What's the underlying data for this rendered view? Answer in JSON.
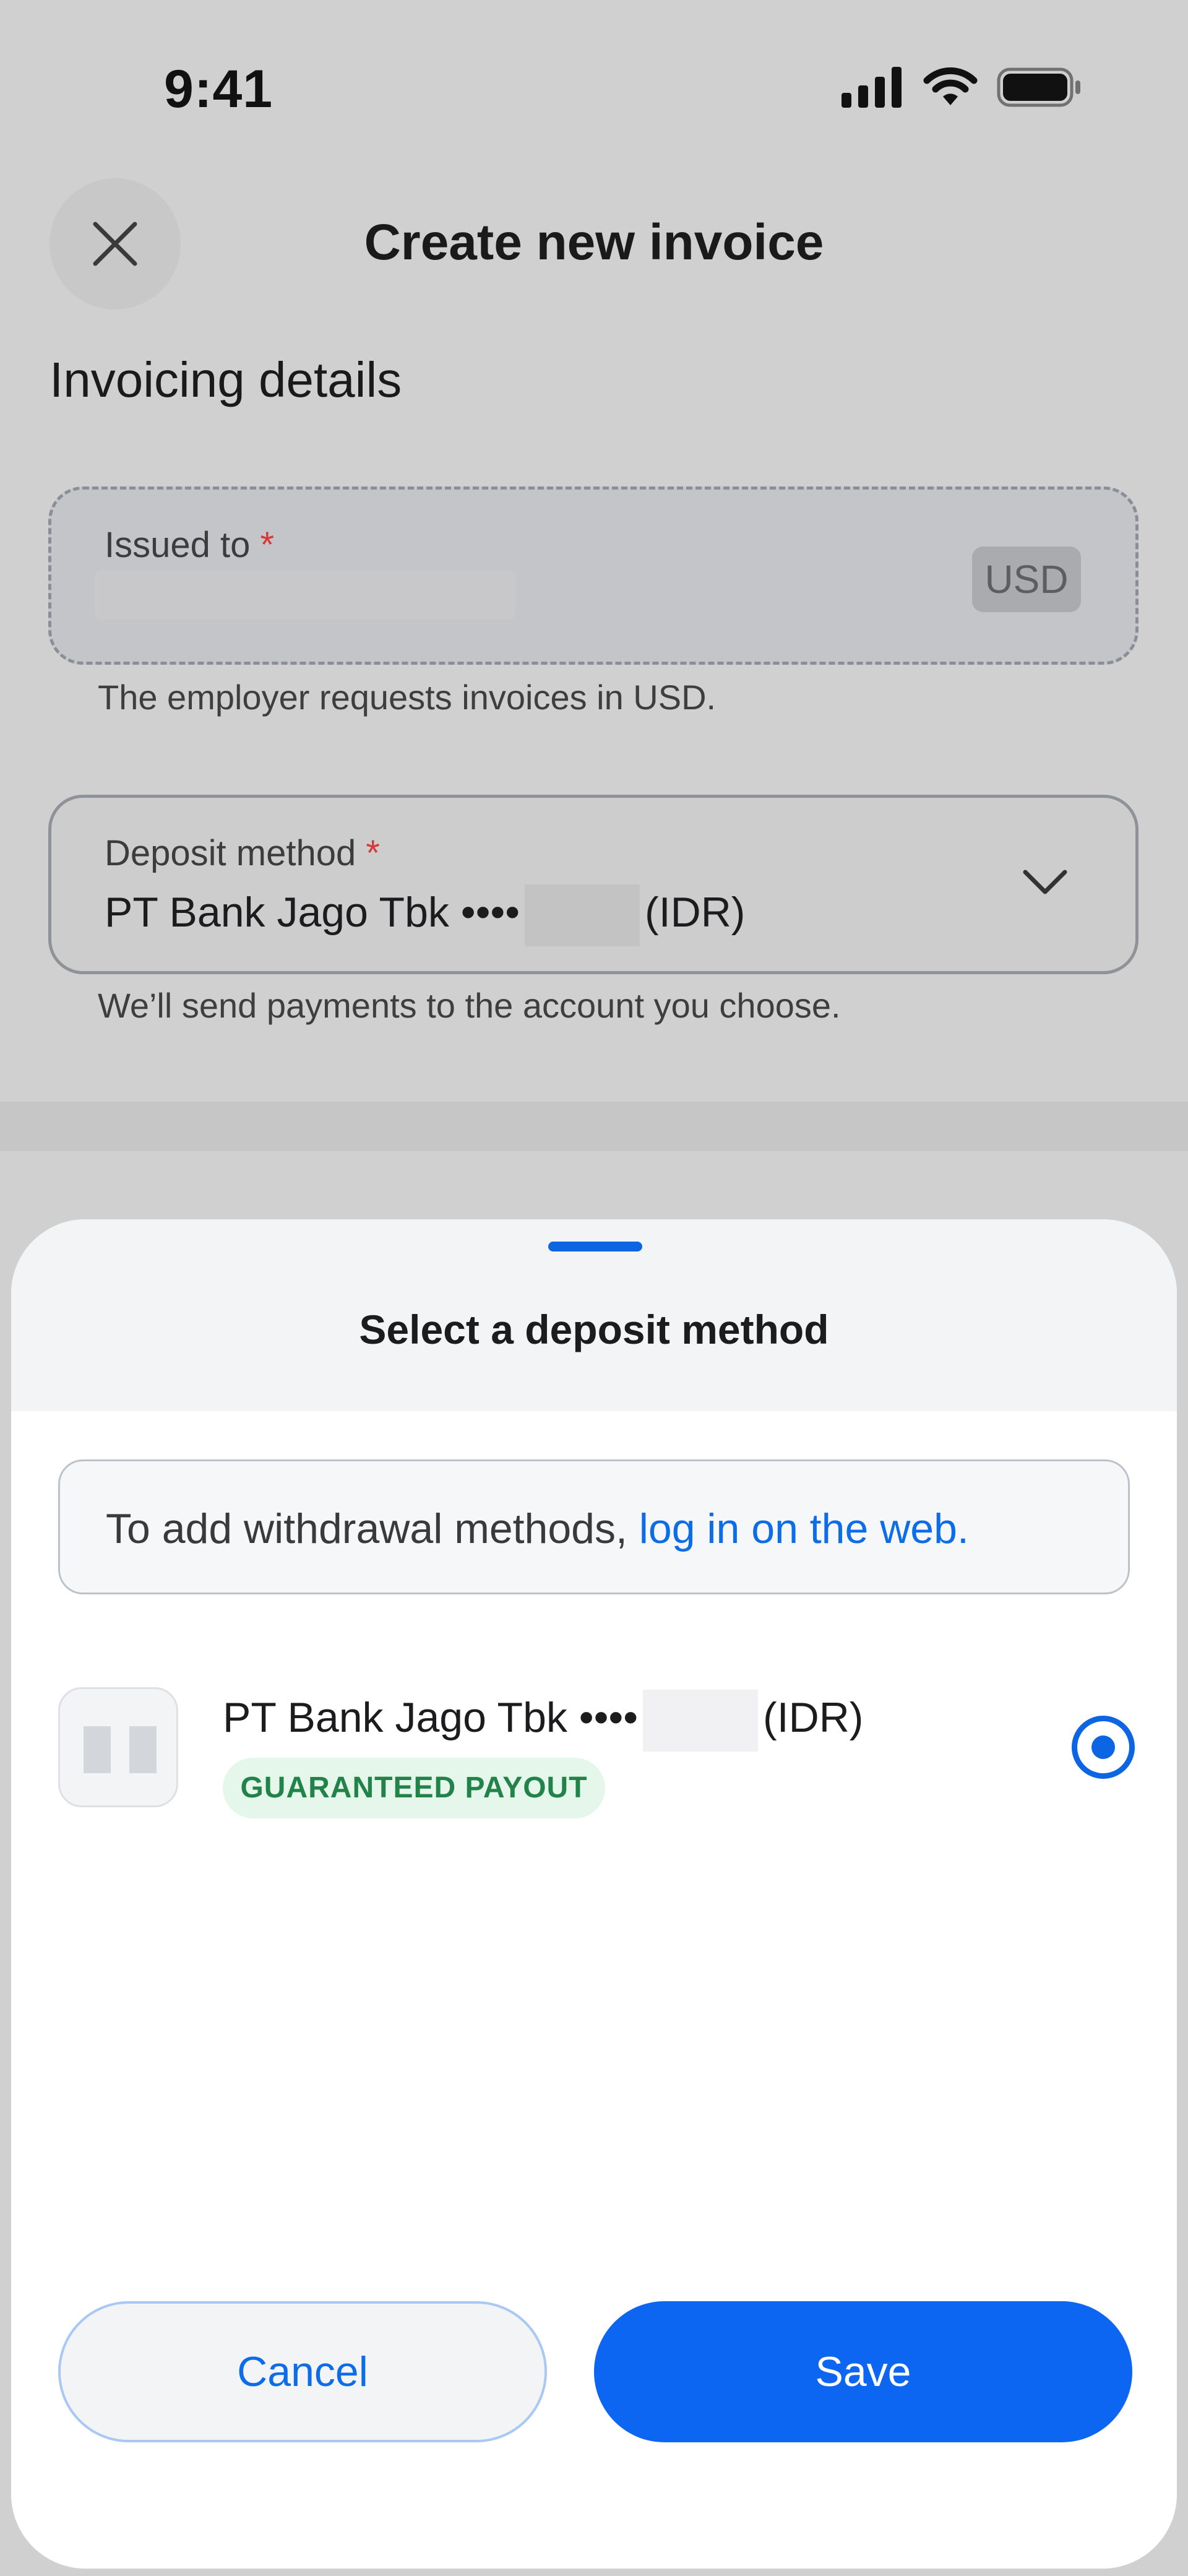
{
  "status_bar": {
    "time": "9:41",
    "icons": [
      "signal-icon",
      "wifi-icon",
      "battery-icon"
    ]
  },
  "header": {
    "title": "Create new invoice",
    "close_icon": "close-icon"
  },
  "invoicing": {
    "section_title": "Invoicing details",
    "issued_to": {
      "label": "Issued to",
      "required_mark": "*",
      "currency": "USD",
      "helper": "The employer requests invoices in USD."
    },
    "deposit": {
      "label": "Deposit method",
      "required_mark": "*",
      "value_prefix": "PT Bank Jago Tbk ••••",
      "value_suffix": "(IDR)",
      "helper": "We’ll send payments to the account you choose."
    }
  },
  "sheet": {
    "title": "Select a deposit method",
    "info_text": "To add withdrawal methods, ",
    "info_link": "log in on the web.",
    "methods": [
      {
        "name_prefix": "PT Bank Jago Tbk ••••",
        "name_suffix": "(IDR)",
        "badge": "GUARANTEED PAYOUT",
        "selected": true
      }
    ],
    "cancel_label": "Cancel",
    "save_label": "Save"
  },
  "colors": {
    "accent": "#0c66e4",
    "success_text": "#21834a",
    "success_bg": "#e5f6ea",
    "required": "#d33b3b"
  }
}
